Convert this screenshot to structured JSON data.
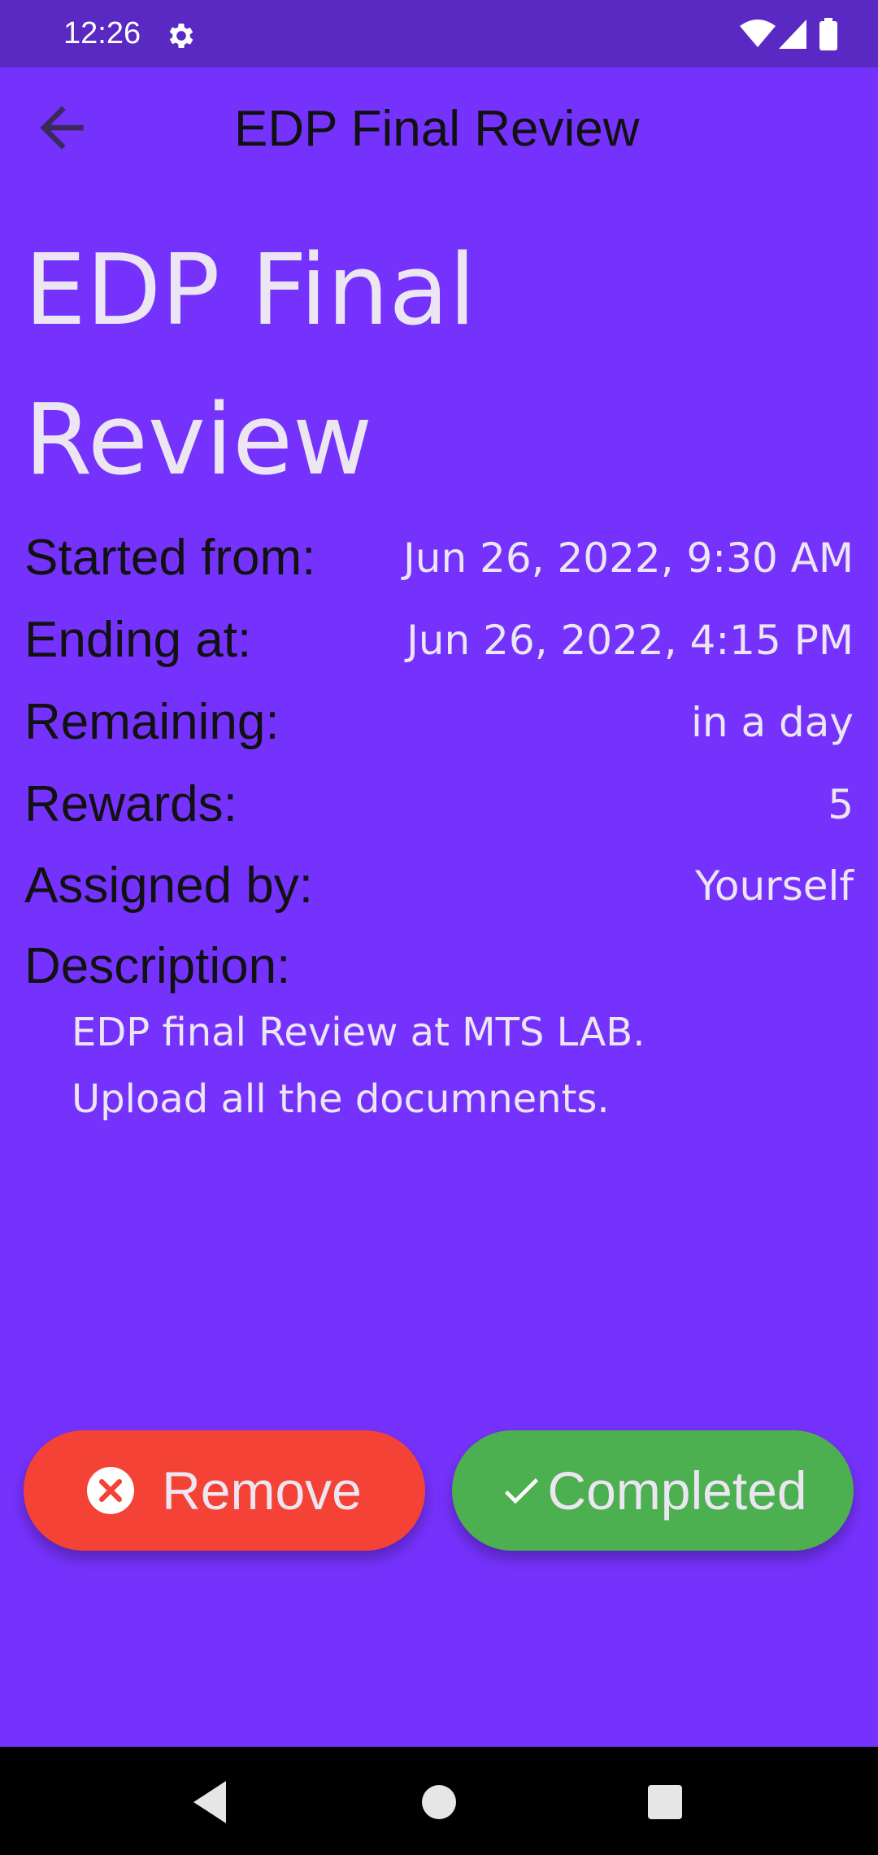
{
  "status_bar": {
    "time": "12:26",
    "icons": [
      "gear-icon",
      "wifi-icon",
      "signal-icon",
      "battery-icon"
    ]
  },
  "app_bar": {
    "title": "EDP Final Review",
    "back_icon": "arrow-back-icon"
  },
  "task": {
    "title": "EDP Final Review",
    "details": [
      {
        "label": "Started from:",
        "value": "Jun 26, 2022, 9:30 AM"
      },
      {
        "label": "Ending at:",
        "value": "Jun 26, 2022, 4:15 PM"
      },
      {
        "label": "Remaining:",
        "value": "in a day"
      },
      {
        "label": "Rewards:",
        "value": "5"
      },
      {
        "label": "Assigned by:",
        "value": "Yourself"
      }
    ],
    "description_label": "Description:",
    "description": "EDP final Review at MTS LAB.\nUpload all the documnents."
  },
  "actions": {
    "remove_label": "Remove",
    "completed_label": "Completed"
  },
  "colors": {
    "background": "#7632fd",
    "status_bar": "#5a29c4",
    "remove": "#f44336",
    "completed": "#4caf50",
    "light_text": "#ebe6f2"
  }
}
